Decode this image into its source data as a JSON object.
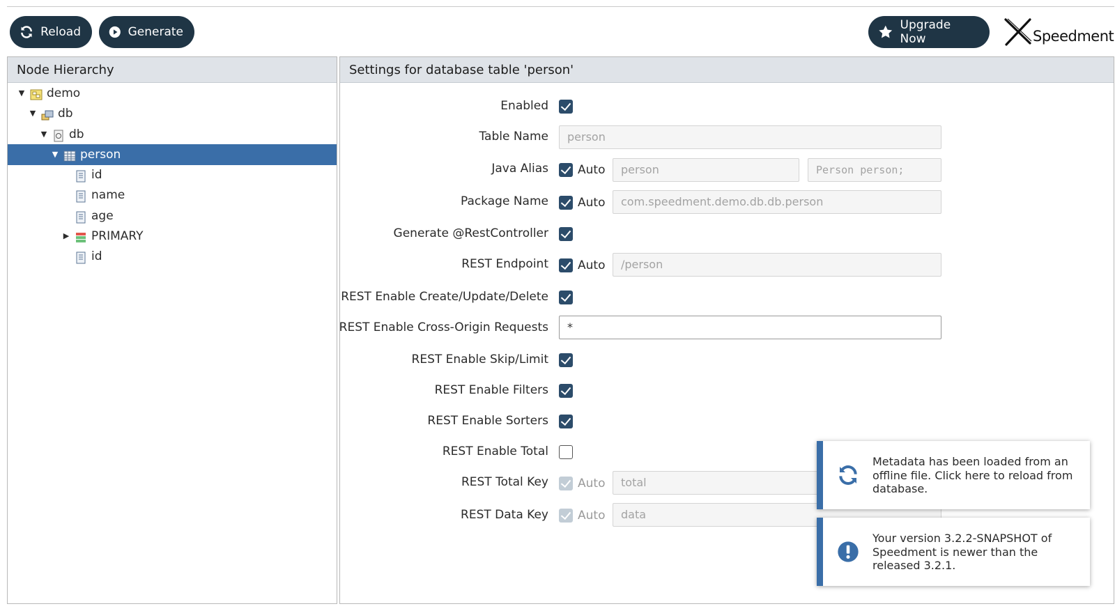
{
  "toolbar": {
    "reload_label": "Reload",
    "generate_label": "Generate",
    "upgrade_label": "Upgrade Now",
    "logo_text": "Speedment"
  },
  "hierarchy": {
    "title": "Node Hierarchy",
    "nodes": [
      {
        "label": "demo",
        "type": "project",
        "expanded": true
      },
      {
        "label": "db",
        "type": "dbms",
        "expanded": true
      },
      {
        "label": "db",
        "type": "schema",
        "expanded": true
      },
      {
        "label": "person",
        "type": "table",
        "expanded": true,
        "selected": true
      },
      {
        "label": "id",
        "type": "column"
      },
      {
        "label": "name",
        "type": "column"
      },
      {
        "label": "age",
        "type": "column"
      },
      {
        "label": "PRIMARY",
        "type": "index",
        "expanded": false
      },
      {
        "label": "id",
        "type": "column"
      }
    ]
  },
  "settings": {
    "title": "Settings for database table 'person'",
    "auto_label": "Auto",
    "rows": {
      "enabled": {
        "label": "Enabled",
        "checked": true
      },
      "table_name": {
        "label": "Table Name",
        "value": "person"
      },
      "java_alias": {
        "label": "Java Alias",
        "auto": true,
        "value": "person",
        "preview": "Person person;"
      },
      "package_name": {
        "label": "Package Name",
        "auto": true,
        "value": "com.speedment.demo.db.db.person"
      },
      "rest_controller": {
        "label": "Generate @RestController",
        "checked": true
      },
      "rest_endpoint": {
        "label": "REST Endpoint",
        "auto": true,
        "value": "/person"
      },
      "rest_crud": {
        "label": "REST Enable Create/Update/Delete",
        "checked": true
      },
      "rest_cors": {
        "label": "REST Enable Cross-Origin Requests",
        "value": "*"
      },
      "rest_skip_limit": {
        "label": "REST Enable Skip/Limit",
        "checked": true
      },
      "rest_filters": {
        "label": "REST Enable Filters",
        "checked": true
      },
      "rest_sorters": {
        "label": "REST Enable Sorters",
        "checked": true
      },
      "rest_total": {
        "label": "REST Enable Total",
        "checked": false
      },
      "rest_total_key": {
        "label": "REST Total Key",
        "auto": true,
        "disabled": true,
        "value": "total"
      },
      "rest_data_key": {
        "label": "REST Data Key",
        "auto": true,
        "disabled": true,
        "value": "data"
      }
    }
  },
  "notifications": [
    {
      "icon": "refresh-icon",
      "text": "Metadata has been loaded from an offline file. Click here to reload from database."
    },
    {
      "icon": "exclamation-icon",
      "text": "Your version 3.2.2-SNAPSHOT of Speedment is newer than the released 3.2.1."
    }
  ],
  "colors": {
    "toolbar_button": "#1f3545",
    "selection": "#3a6ea8",
    "checkbox": "#2c4c6a",
    "notification_accent": "#3a6ea8"
  }
}
